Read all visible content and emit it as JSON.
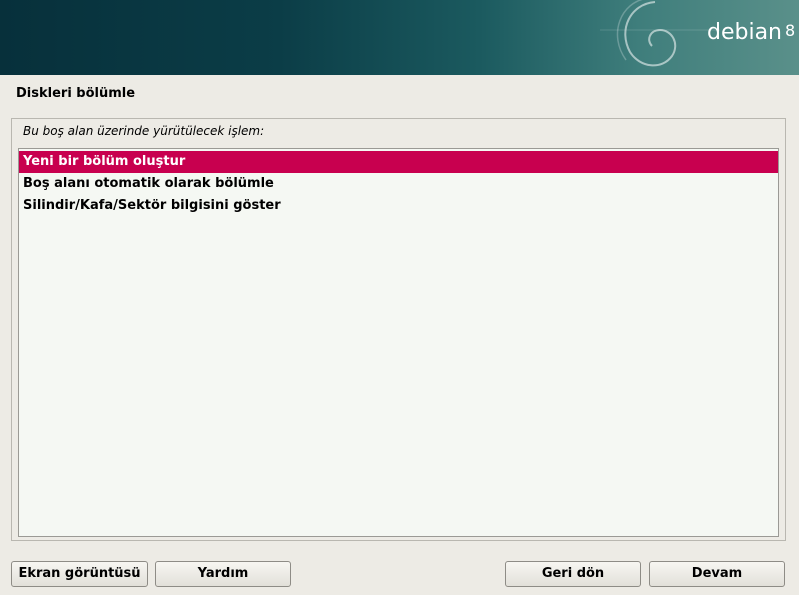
{
  "banner": {
    "brand": "debian",
    "version": "8"
  },
  "page": {
    "title": "Diskleri bölümle"
  },
  "dialog": {
    "prompt": "Bu boş alan üzerinde yürütülecek işlem:",
    "options": [
      {
        "label": "Yeni bir bölüm oluştur",
        "selected": true
      },
      {
        "label": "Boş alanı otomatik olarak bölümle",
        "selected": false
      },
      {
        "label": "Silindir/Kafa/Sektör bilgisini göster",
        "selected": false
      }
    ]
  },
  "buttons": {
    "screenshot": "Ekran görüntüsü",
    "help": "Yardım",
    "back": "Geri dön",
    "continue": "Devam"
  },
  "colors": {
    "selection": "#c8004f",
    "banner_dark": "#07303b",
    "background": "#edebe5"
  }
}
